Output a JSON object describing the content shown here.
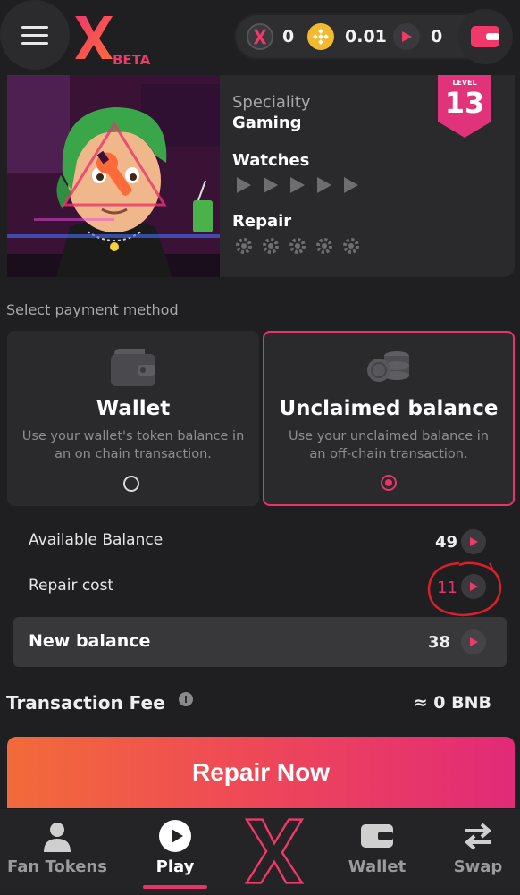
{
  "header": {
    "beta_label": "BETA",
    "balances": {
      "x_tokens": "0",
      "bnb": "0.01",
      "play_tokens": "0"
    }
  },
  "nft": {
    "speciality_label": "Speciality",
    "speciality_value": "Gaming",
    "watches_label": "Watches",
    "watches_count": 5,
    "repair_label": "Repair",
    "repair_count": 5,
    "level_label": "LEVEL",
    "level_value": "13"
  },
  "payment": {
    "section_label": "Select payment method",
    "options": [
      {
        "title": "Wallet",
        "description": "Use your wallet's token balance in an on chain transaction.",
        "selected": false
      },
      {
        "title": "Unclaimed balance",
        "description": "Use your unclaimed balance in an off-chain transaction.",
        "selected": true
      }
    ]
  },
  "summary": {
    "available_label": "Available Balance",
    "available_value": "49",
    "repair_cost_label": "Repair cost",
    "repair_cost_value": "11",
    "new_balance_label": "New balance",
    "new_balance_value": "38"
  },
  "fee": {
    "label": "Transaction Fee",
    "info_glyph": "i",
    "value": "≈ 0 BNB"
  },
  "action": {
    "repair_label": "Repair Now"
  },
  "nav": {
    "items": [
      {
        "label": "Fan Tokens",
        "icon": "user-icon"
      },
      {
        "label": "Play",
        "icon": "play-icon",
        "active": true
      },
      {
        "label": "",
        "icon": "x-logo-icon"
      },
      {
        "label": "Wallet",
        "icon": "wallet-icon"
      },
      {
        "label": "Swap",
        "icon": "swap-icon"
      }
    ]
  },
  "colors": {
    "accent": "#e8336b",
    "brand_gradient_start": "#f26b3a",
    "brand_gradient_end": "#e22a78",
    "annotation": "#d81f2a"
  }
}
